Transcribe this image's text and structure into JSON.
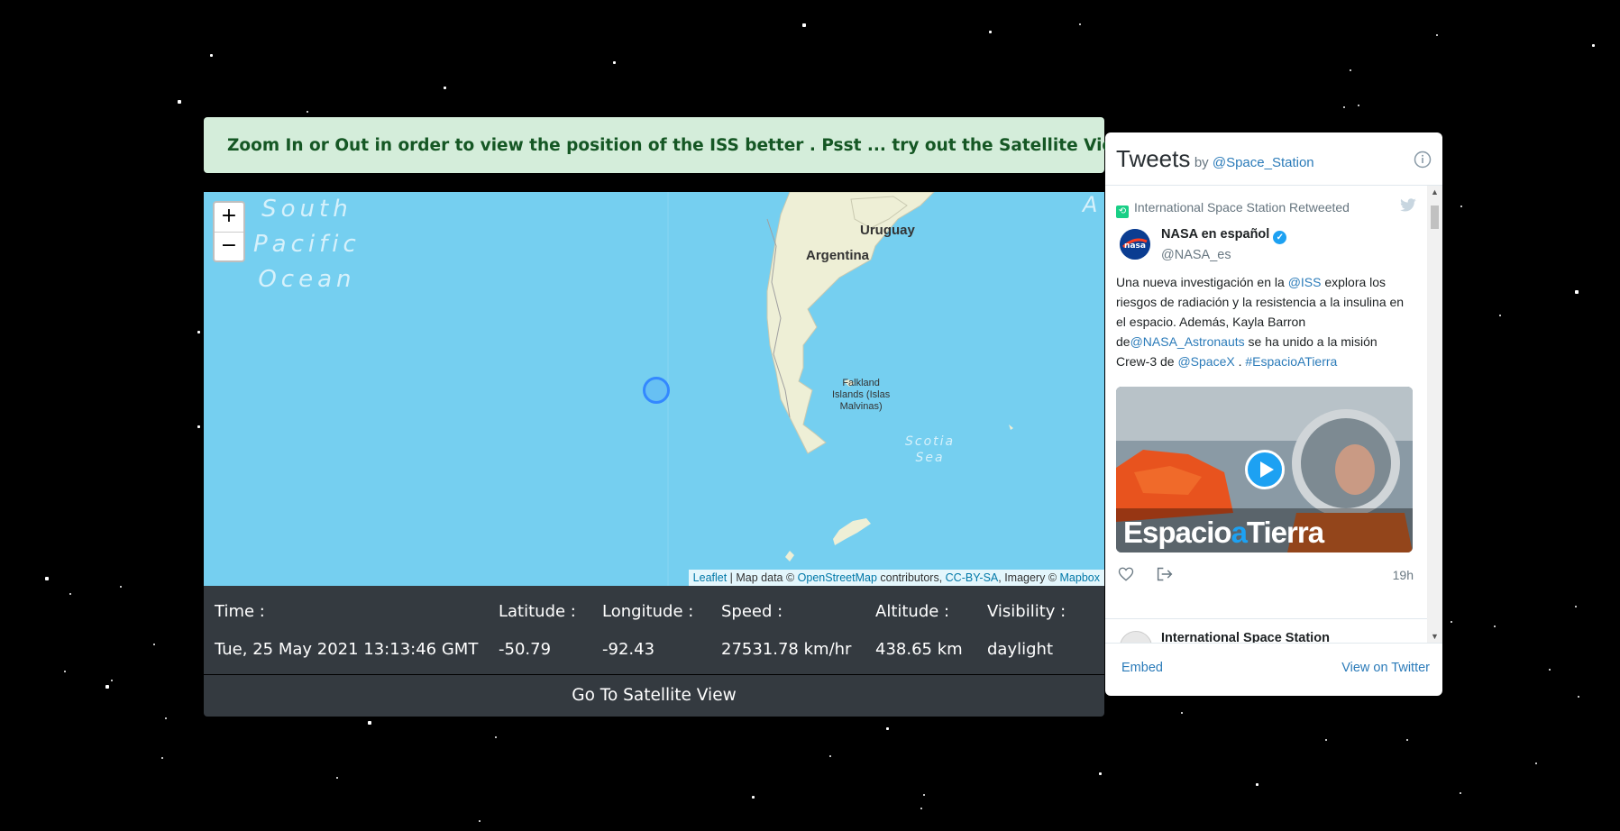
{
  "banner": {
    "text": "Zoom In or Out in order to view the position of the ISS better . Psst ... try out the Satellite View"
  },
  "map": {
    "zoom_in_label": "+",
    "zoom_out_label": "−",
    "ocean_labels": {
      "south_pacific": [
        "South",
        "Pacific",
        "Ocean"
      ],
      "scotia": [
        "Scotia",
        "Sea"
      ],
      "edge": "A"
    },
    "country_labels": {
      "uruguay": "Uruguay",
      "argentina": "Argentina",
      "falkland": [
        "Falkland",
        "Islands (Islas",
        "Malvinas)"
      ]
    },
    "attribution": {
      "leaflet": "Leaflet",
      "map_data": " | Map data © ",
      "osm": "OpenStreetMap",
      "contributors": " contributors, ",
      "license": "CC-BY-SA",
      "imagery": ", Imagery © ",
      "mapbox": "Mapbox"
    },
    "land_color": "#eeefd6",
    "water_color": "#75cff0",
    "marker_color": "#3388ff"
  },
  "info": {
    "time": {
      "label": "Time :",
      "value": "Tue, 25 May 2021 13:13:46 GMT"
    },
    "latitude": {
      "label": "Latitude :",
      "value": "-50.79"
    },
    "longitude": {
      "label": "Longitude :",
      "value": "-92.43"
    },
    "speed": {
      "label": "Speed :",
      "value": "27531.78 km/hr"
    },
    "altitude": {
      "label": "Altitude :",
      "value": "438.65 km"
    },
    "visibility": {
      "label": "Visibility :",
      "value": "daylight"
    }
  },
  "satellite_button": "Go To Satellite View",
  "tweets": {
    "title": "Tweets",
    "by": "by ",
    "handle": "@Space_Station",
    "retweeted": "International Space Station Retweeted",
    "author_name": "NASA en español",
    "author_handle": "@NASA_es",
    "text_parts": {
      "p1": "Una nueva investigación en la ",
      "l1": "@ISS",
      "p2": " explora los riesgos de radiación y la resistencia a la insulina en el espacio. Además, Kayla Barron de",
      "l2": "@NASA_Astronauts",
      "p3": " se ha unido a la misión Crew-3 de ",
      "l3": "@SpaceX",
      "p4": " . ",
      "l4": "#EspacioATierra"
    },
    "media_text_1": "Espacio",
    "media_text_2": "a",
    "media_text_3": "Tierra",
    "time_ago": "19h",
    "next_author": "International Space Station",
    "embed": "Embed",
    "view_on_twitter": "View on Twitter"
  }
}
